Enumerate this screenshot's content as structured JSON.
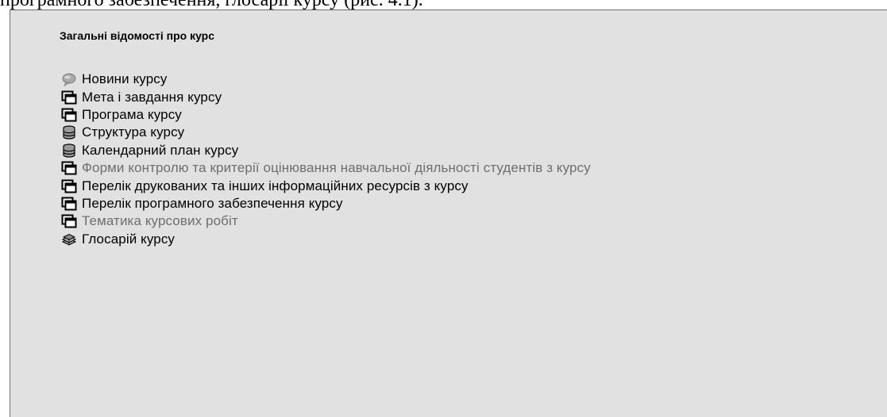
{
  "caption": "програмного забезпечення, глосарії курсу (рис. 4.1).",
  "section_title": "Загальні відомості про курс",
  "items": [
    {
      "label": "Новини курсу",
      "icon": "forum-icon",
      "dimmed": false
    },
    {
      "label": "Мета і завдання курсу",
      "icon": "resource-window-icon",
      "dimmed": false
    },
    {
      "label": "Програма курсу",
      "icon": "resource-window-icon",
      "dimmed": false
    },
    {
      "label": "Структура курсу",
      "icon": "database-icon",
      "dimmed": false
    },
    {
      "label": "Календарний план курсу",
      "icon": "database-icon",
      "dimmed": false
    },
    {
      "label": "Форми контролю та критерії оцінювання навчальної діяльності студентів з курсу",
      "icon": "resource-window-icon",
      "dimmed": true
    },
    {
      "label": "Перелік друкованих та інших інформаційних ресурсів з курсу",
      "icon": "resource-window-icon",
      "dimmed": false
    },
    {
      "label": "Перелік програмного забезпечення курсу",
      "icon": "resource-window-icon",
      "dimmed": false
    },
    {
      "label": "Тематика курсових робіт",
      "icon": "resource-window-icon",
      "dimmed": true
    },
    {
      "label": "Глосарій курсу",
      "icon": "glossary-books-icon",
      "dimmed": false
    }
  ],
  "colors": {
    "panel_background": "#e1e1e1",
    "panel_border": "#6f6f6f",
    "text_normal": "#000000",
    "text_dimmed": "#6e6e6e"
  }
}
